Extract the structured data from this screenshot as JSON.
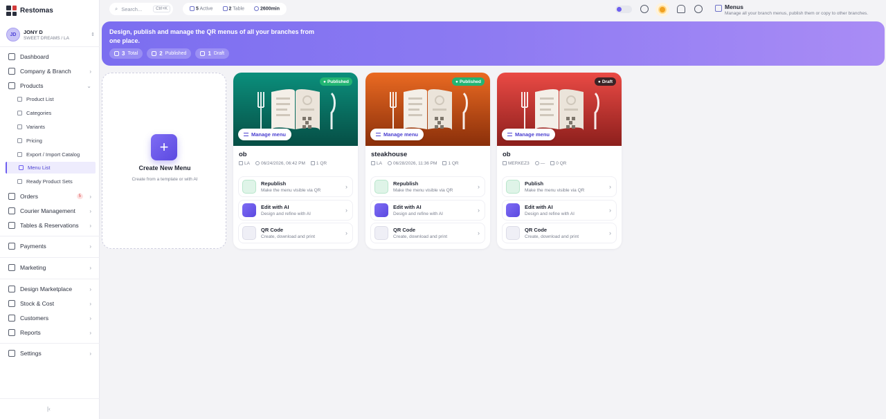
{
  "app": {
    "name": "Restomas"
  },
  "user": {
    "initials": "JD",
    "name": "JONY D",
    "subtitle": "SWEET DREAMS / LA"
  },
  "sidebar": {
    "items": [
      {
        "label": "Dashboard",
        "icon": "dashboard-icon"
      },
      {
        "label": "Company & Branch",
        "icon": "building-icon"
      },
      {
        "label": "Products",
        "icon": "box-icon"
      },
      {
        "label": "Orders",
        "icon": "cart-icon",
        "badge": "5"
      },
      {
        "label": "Courier Management",
        "icon": "courier-icon"
      },
      {
        "label": "Tables & Reservations",
        "icon": "table-icon"
      },
      {
        "label": "Payments",
        "icon": "card-icon"
      },
      {
        "label": "Marketing",
        "icon": "megaphone-icon"
      },
      {
        "label": "Design Marketplace",
        "icon": "palette-icon"
      },
      {
        "label": "Stock & Cost",
        "icon": "stock-icon"
      },
      {
        "label": "Customers",
        "icon": "users-icon"
      },
      {
        "label": "Reports",
        "icon": "chart-icon"
      },
      {
        "label": "Settings",
        "icon": "gear-icon"
      }
    ],
    "product_sub": [
      {
        "label": "Product List"
      },
      {
        "label": "Categories"
      },
      {
        "label": "Variants"
      },
      {
        "label": "Pricing"
      },
      {
        "label": "Export / Import Catalog"
      },
      {
        "label": "Menu List"
      },
      {
        "label": "Ready Product Sets"
      }
    ]
  },
  "topbar": {
    "search_placeholder": "Search...",
    "search_shortcut": "Ctrl+K",
    "active_count": "5",
    "active_label": "Active",
    "table_count": "2",
    "table_label": "Table",
    "minutes": "2600min"
  },
  "page": {
    "title": "Menus",
    "subtitle": "Manage all your branch menus, publish them or copy to other branches."
  },
  "banner": {
    "text": "Design, publish and manage the QR menus of all your branches from one place.",
    "chips": [
      {
        "count": "3",
        "label": "Total"
      },
      {
        "count": "2",
        "label": "Published"
      },
      {
        "count": "1",
        "label": "Draft"
      }
    ]
  },
  "create_card": {
    "title": "Create New Menu",
    "subtitle": "Create from a template or with AI"
  },
  "manage_label": "Manage menu",
  "menus": [
    {
      "name": "ob",
      "status": "Published",
      "branch": "LA",
      "date": "06/24/2026, 06:42 PM",
      "qr": "1 QR",
      "colors": {
        "top": "#0b8f7c",
        "bottom": "#064e45"
      },
      "actions": [
        {
          "title": "Republish",
          "subtitle": "Make the menu visible via QR"
        },
        {
          "title": "Edit with AI",
          "subtitle": "Design and refine with AI"
        },
        {
          "title": "QR Code",
          "subtitle": "Create, download and print"
        }
      ]
    },
    {
      "name": "steakhouse",
      "status": "Published",
      "branch": "LA",
      "date": "06/28/2026, 11:36 PM",
      "qr": "1 QR",
      "colors": {
        "top": "#ea6a22",
        "bottom": "#8a2f0a"
      },
      "actions": [
        {
          "title": "Republish",
          "subtitle": "Make the menu visible via QR"
        },
        {
          "title": "Edit with AI",
          "subtitle": "Design and refine with AI"
        },
        {
          "title": "QR Code",
          "subtitle": "Create, download and print"
        }
      ]
    },
    {
      "name": "ob",
      "status": "Draft",
      "branch": "MERKEZ3",
      "date": "—",
      "qr": "0 QR",
      "colors": {
        "top": "#ea4a45",
        "bottom": "#8c1f1c"
      },
      "actions": [
        {
          "title": "Publish",
          "subtitle": "Make the menu visible via QR"
        },
        {
          "title": "Edit with AI",
          "subtitle": "Design and refine with AI"
        },
        {
          "title": "QR Code",
          "subtitle": "Create, download and print"
        }
      ]
    }
  ]
}
